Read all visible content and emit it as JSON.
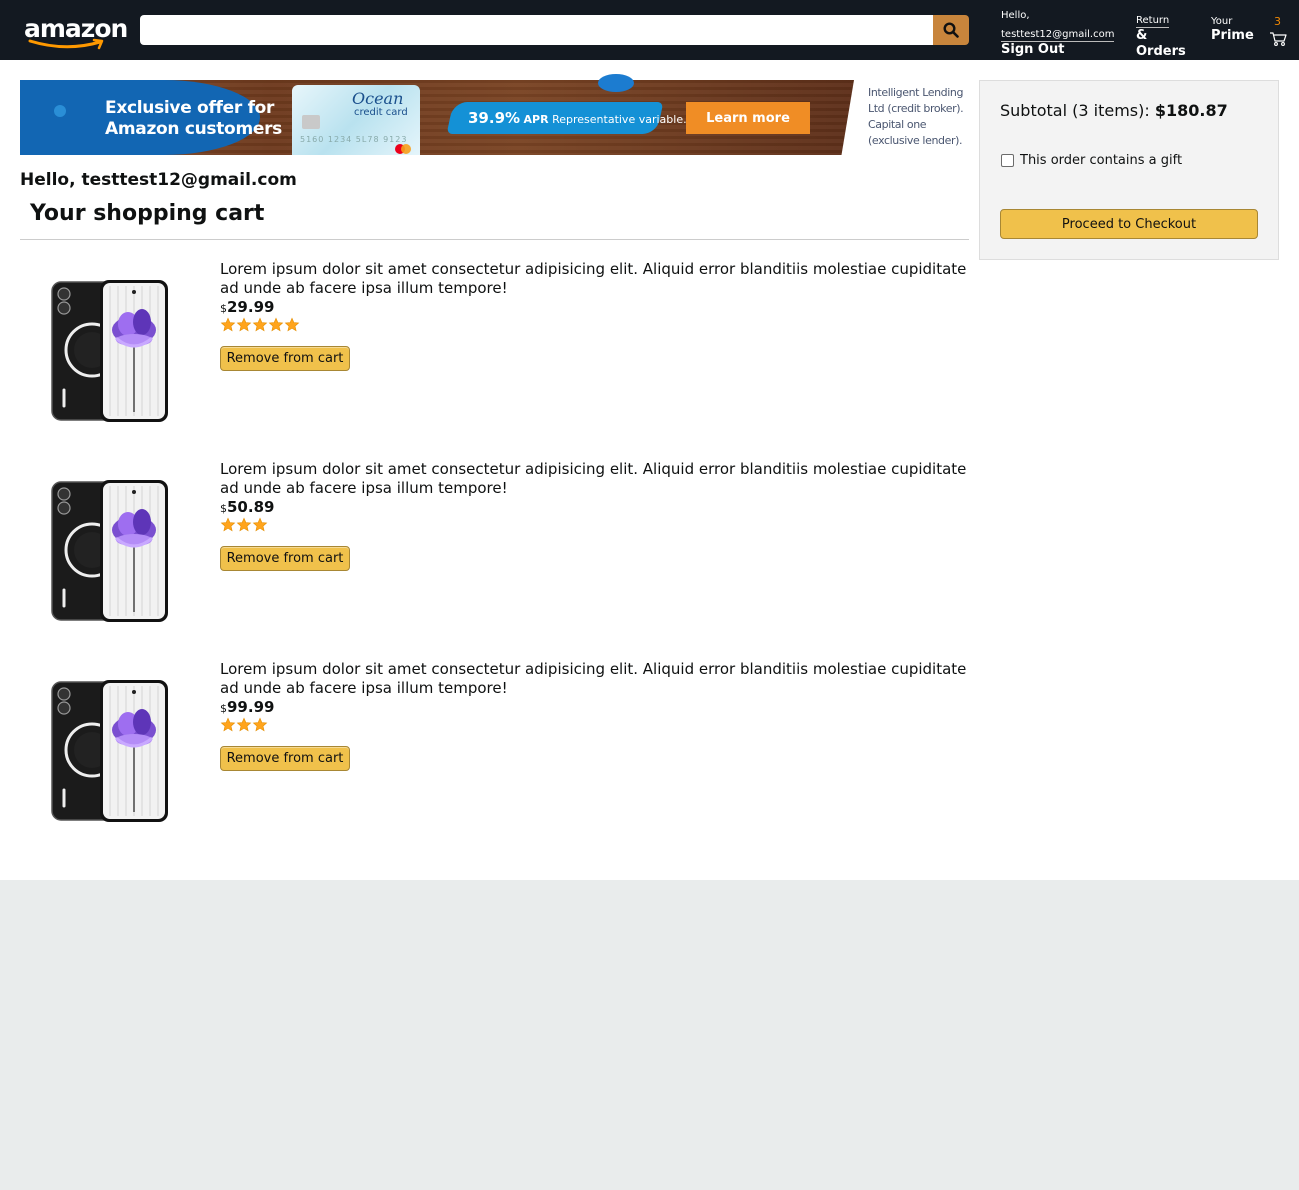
{
  "header": {
    "logo_text": "amazon",
    "search": {
      "value": "",
      "placeholder": ""
    },
    "account": {
      "greeting": "Hello,",
      "email": "testtest12@gmail.com",
      "action": "Sign Out"
    },
    "returns": {
      "line1": "Return",
      "line2": "&",
      "line3": "Orders"
    },
    "prime": {
      "line1": "Your",
      "line2": "Prime"
    },
    "cart_count": "3"
  },
  "banner": {
    "headline": "Exclusive offer for\nAmazon customers",
    "card_name": "Ocean",
    "card_sub": "credit card",
    "card_numbers": "5160 1234 5L78 9123",
    "apr_value": "39.9%",
    "apr_label": "APR",
    "apr_note": "Representative variable.",
    "cta": "Learn more",
    "legal": "Intelligent Lending Ltd (credit broker). Capital one (exclusive lender)."
  },
  "page": {
    "hello": "Hello, testtest12@gmail.com",
    "title": "Your shopping cart"
  },
  "items": [
    {
      "description": "Lorem ipsum dolor sit amet consectetur adipisicing elit. Aliquid error blanditiis molestiae cupiditate ad unde ab facere ipsa illum tempore!",
      "currency": "$",
      "price": "29.99",
      "rating": 5,
      "remove_label": "Remove from cart"
    },
    {
      "description": "Lorem ipsum dolor sit amet consectetur adipisicing elit. Aliquid error blanditiis molestiae cupiditate ad unde ab facere ipsa illum tempore!",
      "currency": "$",
      "price": "50.89",
      "rating": 3,
      "remove_label": "Remove from cart"
    },
    {
      "description": "Lorem ipsum dolor sit amet consectetur adipisicing elit. Aliquid error blanditiis molestiae cupiditate ad unde ab facere ipsa illum tempore!",
      "currency": "$",
      "price": "99.99",
      "rating": 3,
      "remove_label": "Remove from cart"
    }
  ],
  "subtotal": {
    "label": "Subtotal (3 items): ",
    "amount": "$180.87",
    "gift_label": "This order contains a gift",
    "gift_checked": false,
    "checkout_label": "Proceed to Checkout"
  },
  "icons": {
    "search": "search-icon",
    "cart": "cart-icon",
    "star": "star-icon",
    "product_image": "phone-image"
  },
  "colors": {
    "header_bg": "#131921",
    "search_button": "#c8853c",
    "button_yellow": "#f0c14b",
    "star": "#ffa41c",
    "cart_count": "#f08804"
  }
}
